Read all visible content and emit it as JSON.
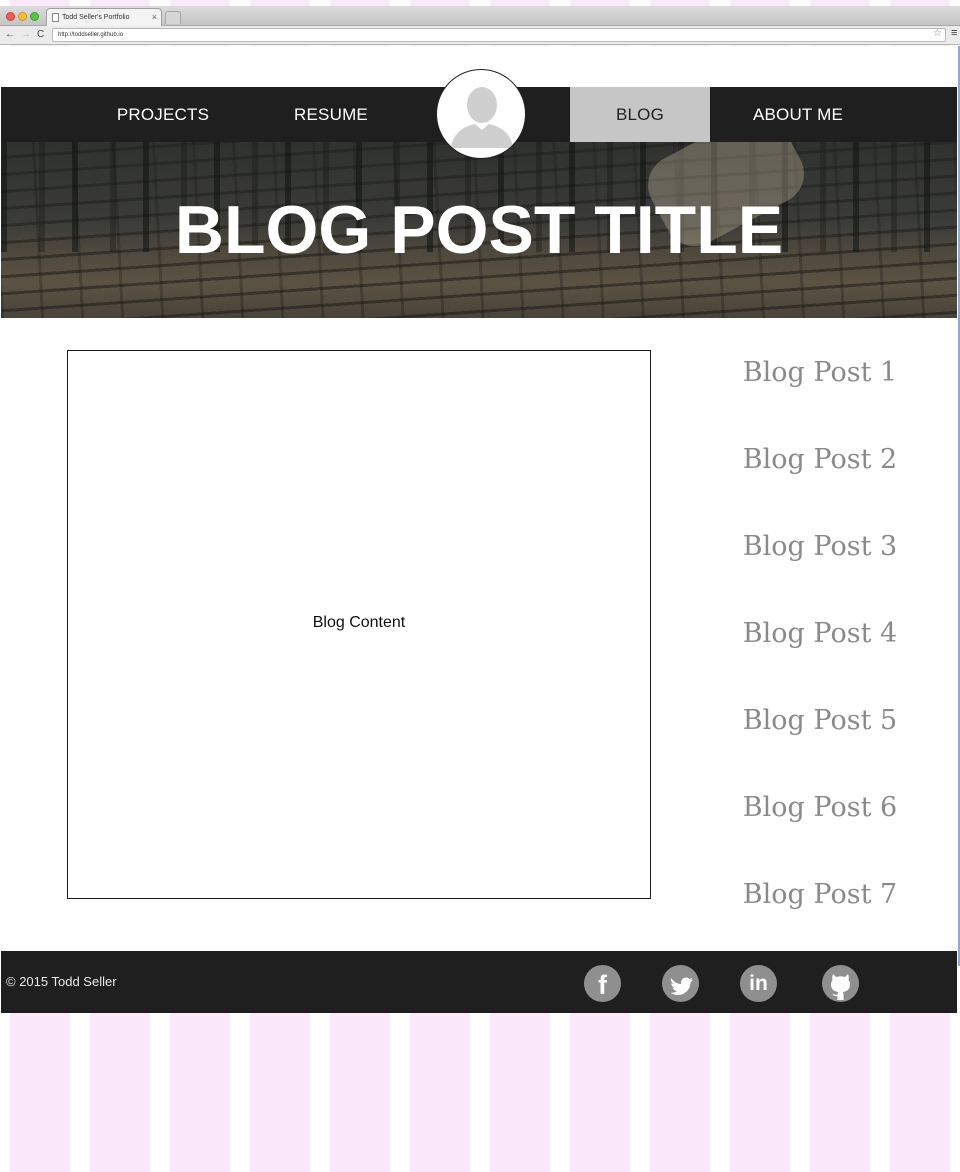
{
  "browser": {
    "tab_title": "Todd Seller's Portfolio",
    "tab_close": "×",
    "url": "http://toddseller.github.io",
    "back": "←",
    "forward": "→",
    "reload": "C",
    "star": "☆",
    "menu": "≡"
  },
  "nav": {
    "items": [
      {
        "label": "PROJECTS",
        "active": false
      },
      {
        "label": "RESUME",
        "active": false
      },
      {
        "label": "BLOG",
        "active": true
      },
      {
        "label": "ABOUT ME",
        "active": false
      }
    ]
  },
  "hero": {
    "title": "BLOG POST TITLE"
  },
  "content": {
    "placeholder": "Blog Content"
  },
  "sidebar": {
    "posts": [
      "Blog Post 1",
      "Blog Post 2",
      "Blog Post 3",
      "Blog Post 4",
      "Blog Post 5",
      "Blog Post 6",
      "Blog Post 7"
    ]
  },
  "footer": {
    "copyright": "© 2015 Todd Seller",
    "social": [
      {
        "icon": "facebook-icon",
        "glyph": "f"
      },
      {
        "icon": "twitter-icon",
        "glyph": ""
      },
      {
        "icon": "linkedin-icon",
        "glyph": "in"
      },
      {
        "icon": "github-icon",
        "glyph": ""
      }
    ]
  },
  "colors": {
    "nav_background": "#1f1f1f",
    "nav_active_background": "#c6c6c6",
    "sidebar_link": "#8a8a8a",
    "social_icon": "#8f8f8f",
    "page_stripe": "#fce8fb"
  }
}
